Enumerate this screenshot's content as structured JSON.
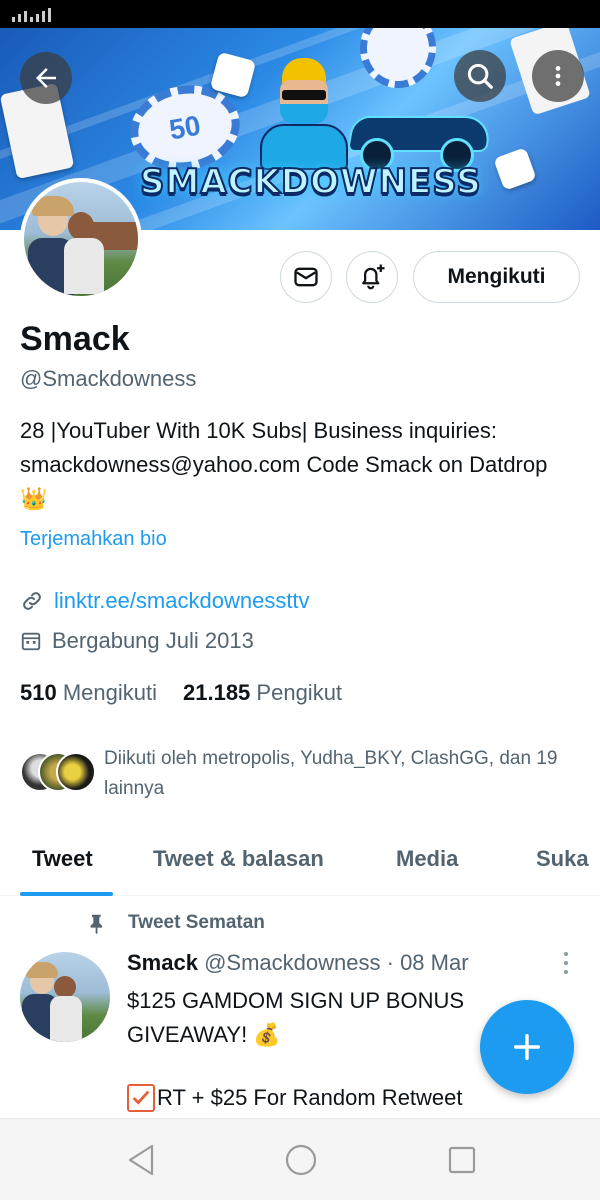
{
  "banner": {
    "title": "SMACKDOWNESS",
    "chip_text": "50",
    "back_icon": "arrow-left-icon",
    "search_icon": "search-icon",
    "more_icon": "more-vertical-icon"
  },
  "profile": {
    "name": "Smack",
    "handle": "@Smackdowness",
    "bio": "28 |YouTuber With 10K Subs| Business inquiries: smackdowness@yahoo.com Code Smack on Datdrop 👑",
    "translate_bio": "Terjemahkan bio",
    "link": "linktr.ee/smackdownessttv",
    "joined": "Bergabung Juli 2013",
    "following_count": "510",
    "following_label": "Mengikuti",
    "followers_count": "21.185",
    "followers_label": "Pengikut",
    "followed_by": "Diikuti oleh metropolis, Yudha_BKY, ClashGG, dan 19 lainnya"
  },
  "actions": {
    "message_icon": "mail-icon",
    "notify_icon": "bell-plus-icon",
    "follow_label": "Mengikuti"
  },
  "tabs": [
    {
      "label": "Tweet",
      "active": true
    },
    {
      "label": "Tweet & balasan",
      "active": false
    },
    {
      "label": "Media",
      "active": false
    },
    {
      "label": "Suka",
      "active": false
    }
  ],
  "pinned_tweet": {
    "pinned_label": "Tweet Sematan",
    "author_name": "Smack",
    "author_handle": "@Smackdowness",
    "separator": "·",
    "date": "08 Mar",
    "text": "$125 GAMDOM SIGN UP BONUS GIVEAWAY! 💰",
    "line2": "RT + $25 For Random Retweet"
  },
  "fab": {
    "icon": "plus-icon"
  },
  "colors": {
    "accent": "#1d9bf0",
    "text": "#0f1419",
    "secondary": "#536471"
  },
  "navbar": {
    "back": "nav-back-icon",
    "home": "nav-home-icon",
    "recents": "nav-recents-icon"
  }
}
